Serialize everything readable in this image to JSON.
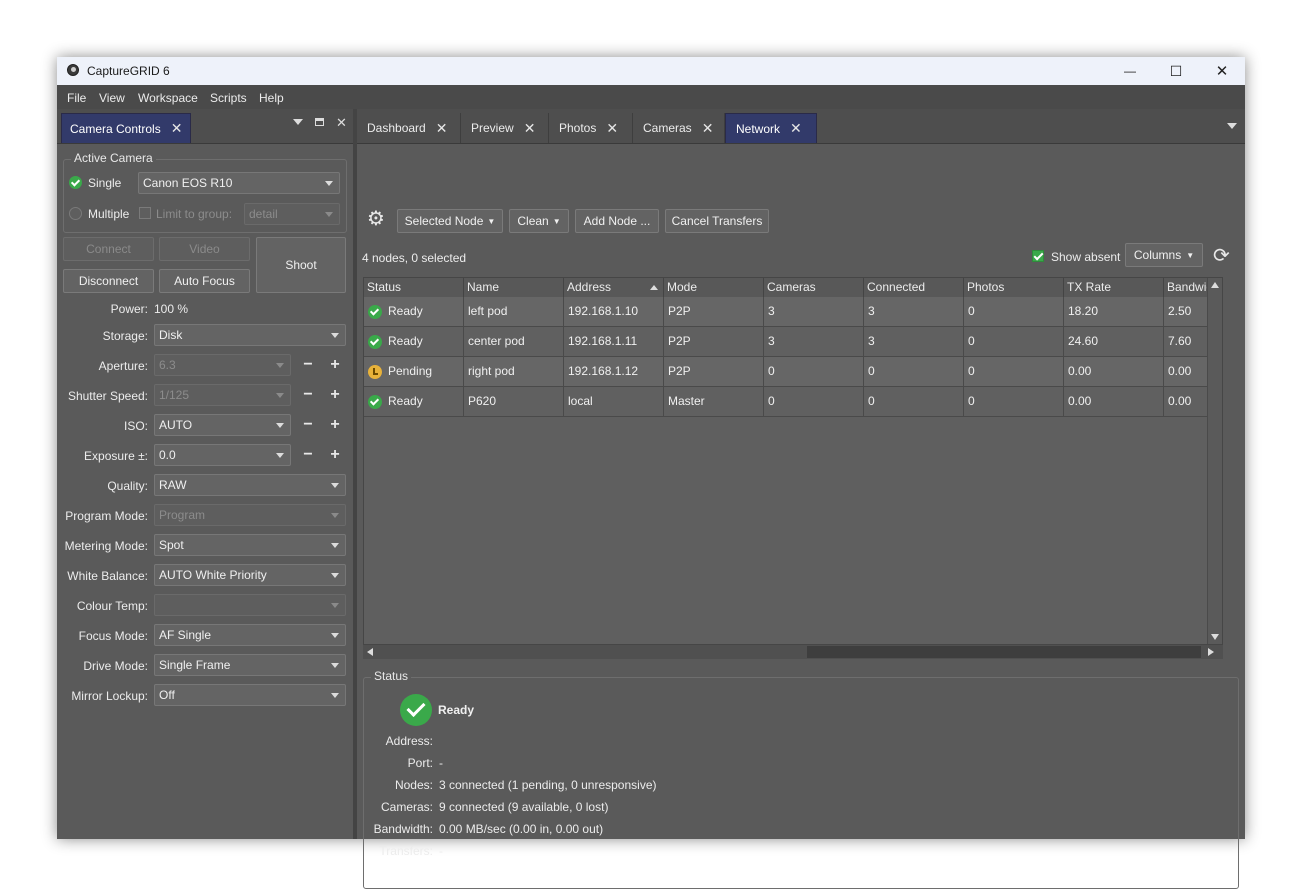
{
  "window": {
    "title": "CaptureGRID 6",
    "controls": {
      "minimize": "—",
      "maximize": "☐",
      "close": "✕"
    }
  },
  "menu": [
    "File",
    "View",
    "Workspace",
    "Scripts",
    "Help"
  ],
  "left_panel": {
    "tab_label": "Camera Controls",
    "active_camera": {
      "group_title": "Active Camera",
      "single_label": "Single",
      "single_value": "Canon EOS R10",
      "multiple_label": "Multiple",
      "limit_label": "Limit to group:",
      "limit_value": "detail"
    },
    "buttons": {
      "connect": "Connect",
      "video": "Video",
      "disconnect": "Disconnect",
      "auto_focus": "Auto Focus",
      "shoot": "Shoot"
    },
    "power_label": "Power:",
    "power_value": "100 %",
    "settings": [
      {
        "label": "Storage:",
        "value": "Disk",
        "disabled": false,
        "stepper": false
      },
      {
        "label": "Aperture:",
        "value": "6.3",
        "disabled": true,
        "stepper": true
      },
      {
        "label": "Shutter Speed:",
        "value": "1/125",
        "disabled": true,
        "stepper": true
      },
      {
        "label": "ISO:",
        "value": "AUTO",
        "disabled": false,
        "stepper": true
      },
      {
        "label": "Exposure ±:",
        "value": "0.0",
        "disabled": false,
        "stepper": true
      },
      {
        "label": "Quality:",
        "value": "RAW",
        "disabled": false,
        "stepper": false
      },
      {
        "label": "Program Mode:",
        "value": "Program",
        "disabled": true,
        "stepper": false
      },
      {
        "label": "Metering Mode:",
        "value": "Spot",
        "disabled": false,
        "stepper": false
      },
      {
        "label": "White Balance:",
        "value": "AUTO White Priority",
        "disabled": false,
        "stepper": false
      },
      {
        "label": "Colour Temp:",
        "value": "",
        "disabled": true,
        "stepper": false
      },
      {
        "label": "Focus Mode:",
        "value": "AF Single",
        "disabled": false,
        "stepper": false
      },
      {
        "label": "Drive Mode:",
        "value": "Single Frame",
        "disabled": false,
        "stepper": false
      },
      {
        "label": "Mirror Lockup:",
        "value": "Off",
        "disabled": false,
        "stepper": false
      }
    ]
  },
  "tabs": [
    "Dashboard",
    "Preview",
    "Photos",
    "Cameras",
    "Network"
  ],
  "active_tab": "Network",
  "toolbar": {
    "selected_node": "Selected Node",
    "clean": "Clean",
    "add_node": "Add Node ...",
    "cancel_transfers": "Cancel Transfers",
    "summary": "4 nodes, 0 selected",
    "show_absent": "Show absent",
    "columns": "Columns"
  },
  "table": {
    "columns": [
      "Status",
      "Name",
      "Address",
      "Mode",
      "Cameras",
      "Connected",
      "Photos",
      "TX Rate",
      "Bandwidth"
    ],
    "rows": [
      {
        "status": "Ready",
        "status_kind": "ready",
        "name": "left pod",
        "address": "192.168.1.10",
        "mode": "P2P",
        "cameras": "3",
        "connected": "3",
        "photos": "0",
        "tx_rate": "18.20",
        "bandwidth": "2.50"
      },
      {
        "status": "Ready",
        "status_kind": "ready",
        "name": "center pod",
        "address": "192.168.1.11",
        "mode": "P2P",
        "cameras": "3",
        "connected": "3",
        "photos": "0",
        "tx_rate": "24.60",
        "bandwidth": "7.60"
      },
      {
        "status": "Pending",
        "status_kind": "pending",
        "name": "right pod",
        "address": "192.168.1.12",
        "mode": "P2P",
        "cameras": "0",
        "connected": "0",
        "photos": "0",
        "tx_rate": "0.00",
        "bandwidth": "0.00"
      },
      {
        "status": "Ready",
        "status_kind": "ready",
        "name": "P620",
        "address": "local",
        "mode": "Master",
        "cameras": "0",
        "connected": "0",
        "photos": "0",
        "tx_rate": "0.00",
        "bandwidth": "0.00"
      }
    ]
  },
  "status": {
    "group_title": "Status",
    "state": "Ready",
    "fields": [
      {
        "label": "Address:",
        "value": ""
      },
      {
        "label": "Port:",
        "value": "-"
      },
      {
        "label": "Nodes:",
        "value": "3 connected (1 pending, 0 unresponsive)"
      },
      {
        "label": "Cameras:",
        "value": "9 connected (9 available, 0 lost)"
      },
      {
        "label": "Bandwidth:",
        "value": "0.00 MB/sec (0.00 in, 0.00 out)"
      },
      {
        "label": "Transfers:",
        "value": "-"
      }
    ]
  }
}
